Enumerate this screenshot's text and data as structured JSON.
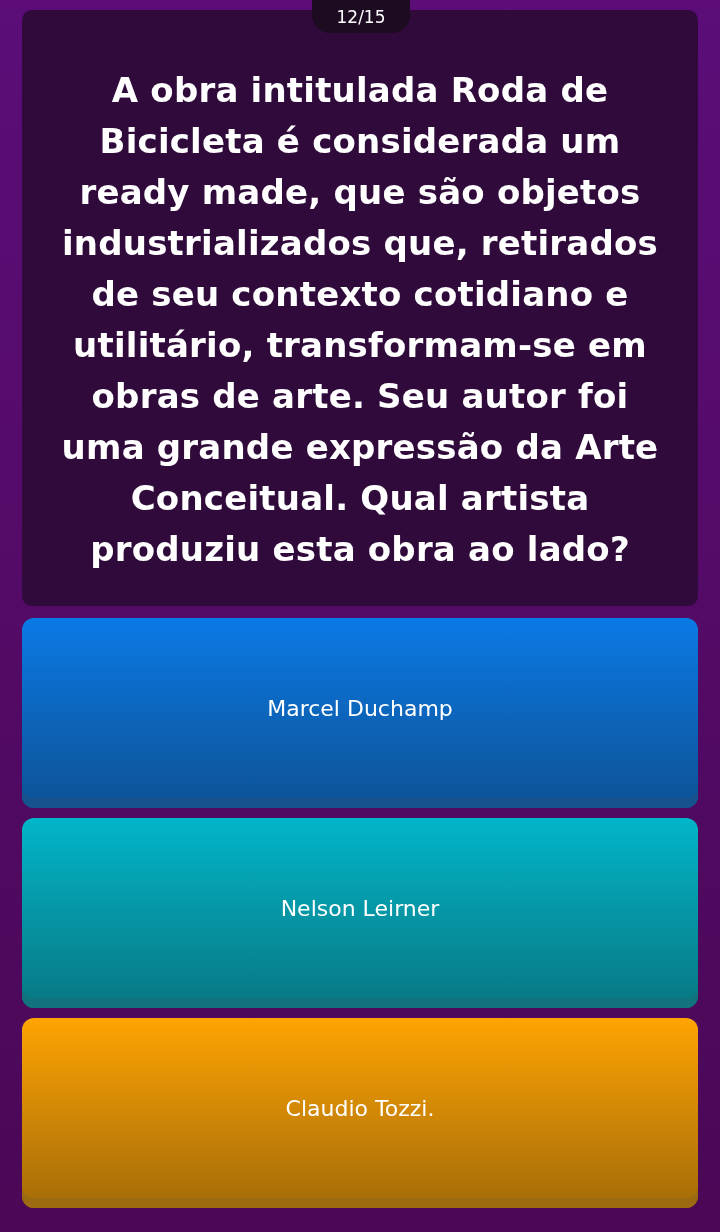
{
  "counter": "12/15",
  "question": "A obra intitulada Roda de Bicicleta é considerada um ready made, que são objetos industrializados que, retirados de seu contexto cotidiano e utilitário, transformam-se em obras de arte. Seu autor foi uma grande expressão da Arte Conceitual. Qual artista produziu esta obra ao lado?",
  "options": [
    {
      "label": "Marcel Duchamp",
      "color": "#0a7ae6"
    },
    {
      "label": "Nelson Leirner",
      "color": "#01b6c9"
    },
    {
      "label": "Claudio Tozzi.",
      "color": "#ffa402"
    }
  ]
}
